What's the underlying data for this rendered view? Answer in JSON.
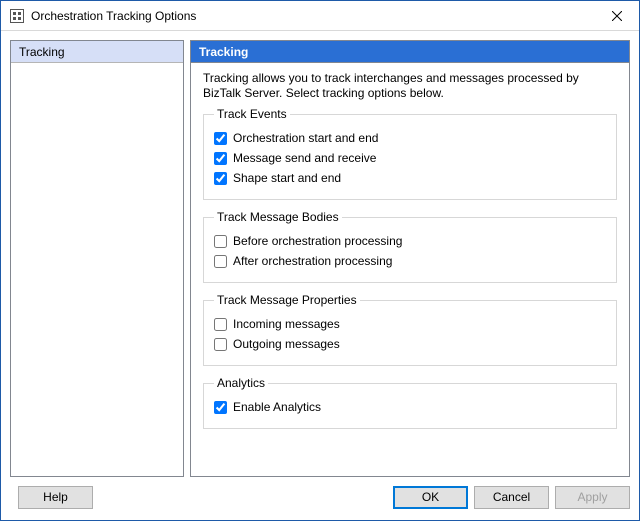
{
  "window": {
    "title": "Orchestration Tracking Options"
  },
  "nav": {
    "items": [
      {
        "label": "Tracking"
      }
    ],
    "selected": 0
  },
  "content": {
    "header": "Tracking",
    "description": "Tracking allows you to track interchanges and messages processed by BizTalk Server. Select tracking options below.",
    "groups": {
      "track_events": {
        "legend": "Track Events",
        "orch_start_end": {
          "label": "Orchestration start and end",
          "checked": true
        },
        "msg_send_recv": {
          "label": "Message send and receive",
          "checked": true
        },
        "shape_start_end": {
          "label": "Shape start and end",
          "checked": true
        }
      },
      "track_bodies": {
        "legend": "Track Message Bodies",
        "before_proc": {
          "label": "Before orchestration processing",
          "checked": false
        },
        "after_proc": {
          "label": "After orchestration processing",
          "checked": false
        }
      },
      "track_props": {
        "legend": "Track Message Properties",
        "incoming": {
          "label": "Incoming messages",
          "checked": false
        },
        "outgoing": {
          "label": "Outgoing messages",
          "checked": false
        }
      },
      "analytics": {
        "legend": "Analytics",
        "enable": {
          "label": "Enable Analytics",
          "checked": true
        }
      }
    }
  },
  "buttons": {
    "help": "Help",
    "ok": "OK",
    "cancel": "Cancel",
    "apply": "Apply",
    "apply_enabled": false
  }
}
